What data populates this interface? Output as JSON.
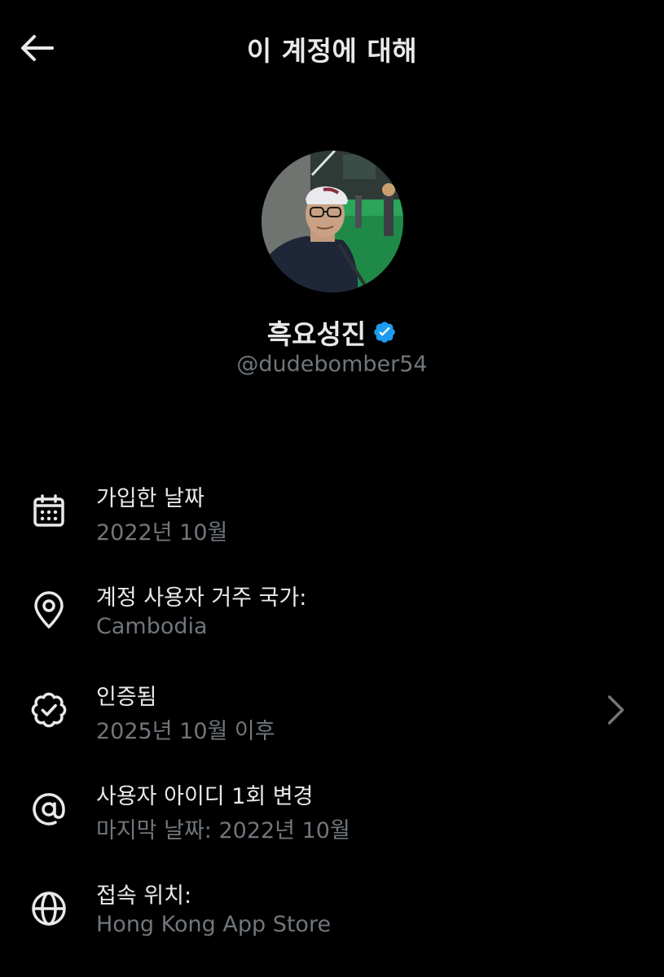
{
  "header": {
    "title": "이 계정에 대해",
    "back_icon": "arrow-left-icon"
  },
  "profile": {
    "display_name": "흑요성진",
    "handle": "@dudebomber54",
    "verified": true,
    "badge_color": "#1d9bf0"
  },
  "rows": [
    {
      "icon": "calendar-icon",
      "label": "가입한 날짜",
      "value": "2022년 10월"
    },
    {
      "icon": "location-pin-icon",
      "label": "계정 사용자 거주 국가:",
      "value": "Cambodia"
    },
    {
      "icon": "verified-check-icon",
      "label": "인증됨",
      "value": "2025년 10월 이후",
      "has_chevron": true
    },
    {
      "icon": "at-sign-icon",
      "label": "사용자 아이디 1회 변경",
      "value": "마지막 날짜: 2022년 10월"
    },
    {
      "icon": "globe-icon",
      "label": "접속 위치:",
      "value": "Hong Kong App Store"
    }
  ],
  "colors": {
    "background": "#000000",
    "primary_text": "#e7e9ea",
    "secondary_text": "#71767b",
    "accent": "#1d9bf0"
  }
}
